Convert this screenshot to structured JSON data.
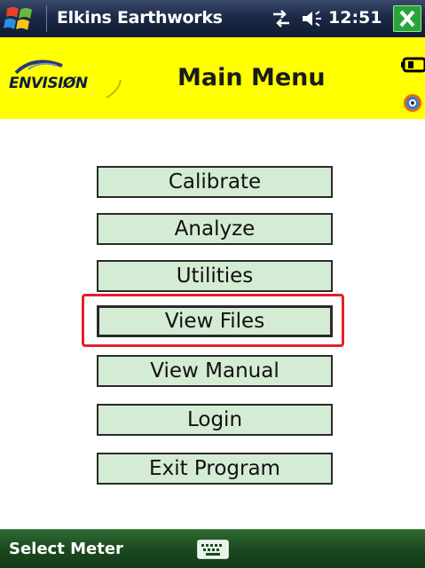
{
  "status_bar": {
    "title": "Elkins Earthworks",
    "time": "12:51",
    "start_icon": "windows-flag-icon",
    "connectivity_icon": "connectivity-arrows-icon",
    "volume_icon": "speaker-icon",
    "close_icon": "close-x-icon"
  },
  "header": {
    "logo_text": "ENVISIØN",
    "title": "Main Menu",
    "battery_icon": "battery-icon",
    "bluetooth_icon": "bluetooth-icon",
    "background_color": "#ffff00"
  },
  "menu": {
    "items": [
      {
        "label": "Calibrate"
      },
      {
        "label": "Analyze"
      },
      {
        "label": "Utilities"
      },
      {
        "label": "View Files",
        "selected": true
      },
      {
        "label": "View Manual"
      },
      {
        "label": "Login"
      },
      {
        "label": "Exit Program"
      }
    ],
    "button_color": "#d4ecd4",
    "highlight_color": "#e3202a"
  },
  "softkey_bar": {
    "left_label": "Select Meter",
    "keyboard_icon": "keyboard-icon"
  }
}
